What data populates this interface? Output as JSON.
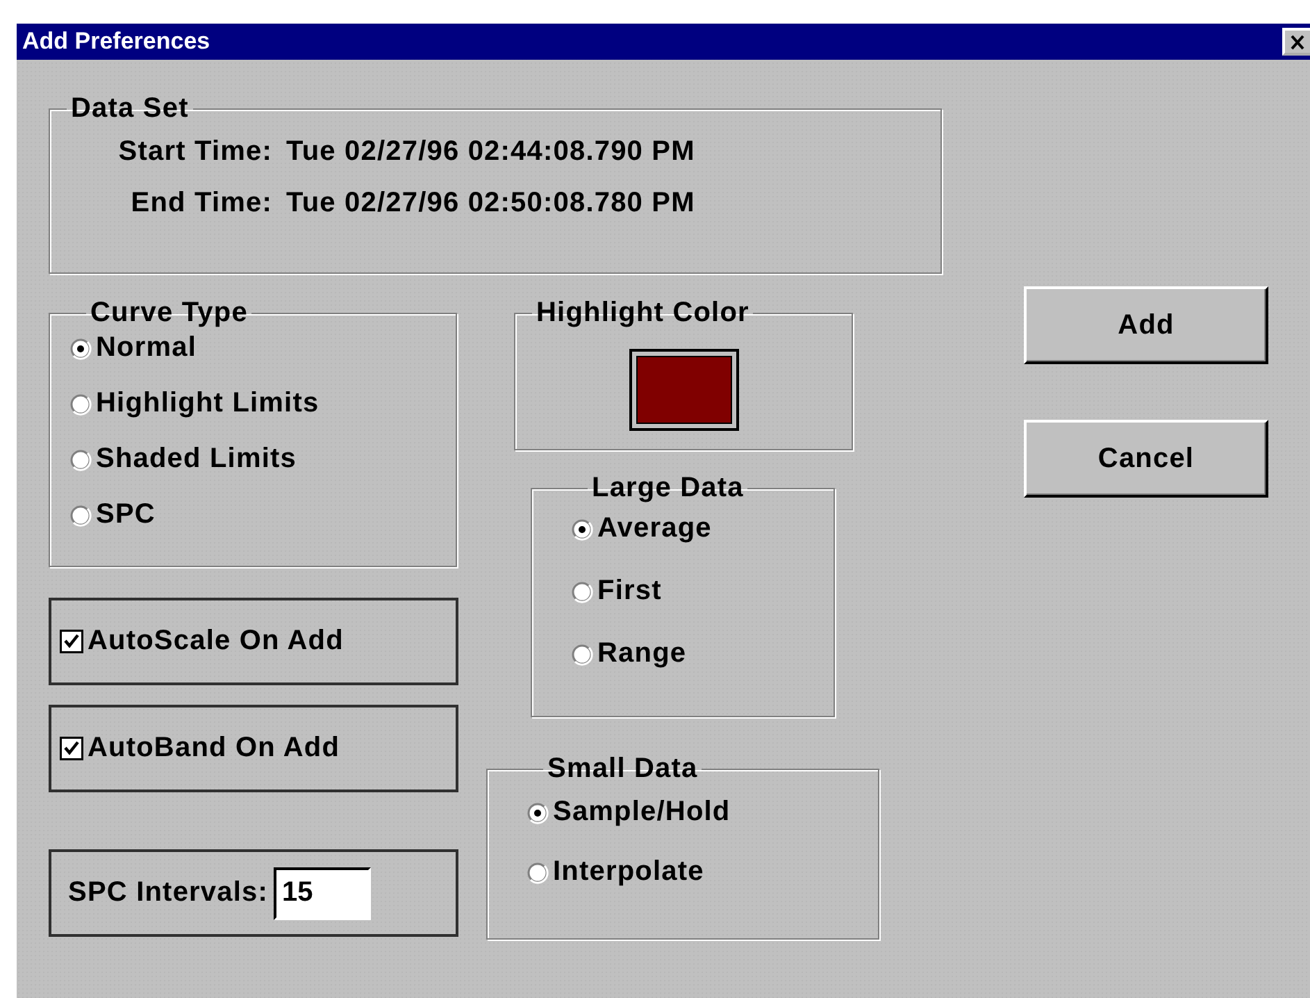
{
  "window": {
    "title": "Add Preferences"
  },
  "data_set": {
    "title": "Data Set",
    "rows": [
      {
        "label": "Start Time:",
        "value": "Tue 02/27/96 02:44:08.790 PM"
      },
      {
        "label": "End Time:",
        "value": "Tue 02/27/96 02:50:08.780 PM"
      }
    ]
  },
  "curve_type": {
    "title": "Curve Type",
    "options": [
      {
        "label": "Normal",
        "selected": true
      },
      {
        "label": "Highlight Limits",
        "selected": false
      },
      {
        "label": "Shaded Limits",
        "selected": false
      },
      {
        "label": "SPC",
        "selected": false
      }
    ]
  },
  "checkboxes": [
    {
      "label": "AutoScale On Add",
      "checked": true
    },
    {
      "label": "AutoBand On Add",
      "checked": true
    }
  ],
  "spc_intervals": {
    "label": "SPC Intervals:",
    "value": "15"
  },
  "highlight_color": {
    "title": "Highlight Color",
    "color": "#800000"
  },
  "large_data": {
    "title": "Large Data",
    "options": [
      {
        "label": "Average",
        "selected": true
      },
      {
        "label": "First",
        "selected": false
      },
      {
        "label": "Range",
        "selected": false
      }
    ]
  },
  "small_data": {
    "title": "Small Data",
    "options": [
      {
        "label": "Sample/Hold",
        "selected": true
      },
      {
        "label": "Interpolate",
        "selected": false
      }
    ]
  },
  "buttons": [
    "Add",
    "Cancel"
  ]
}
